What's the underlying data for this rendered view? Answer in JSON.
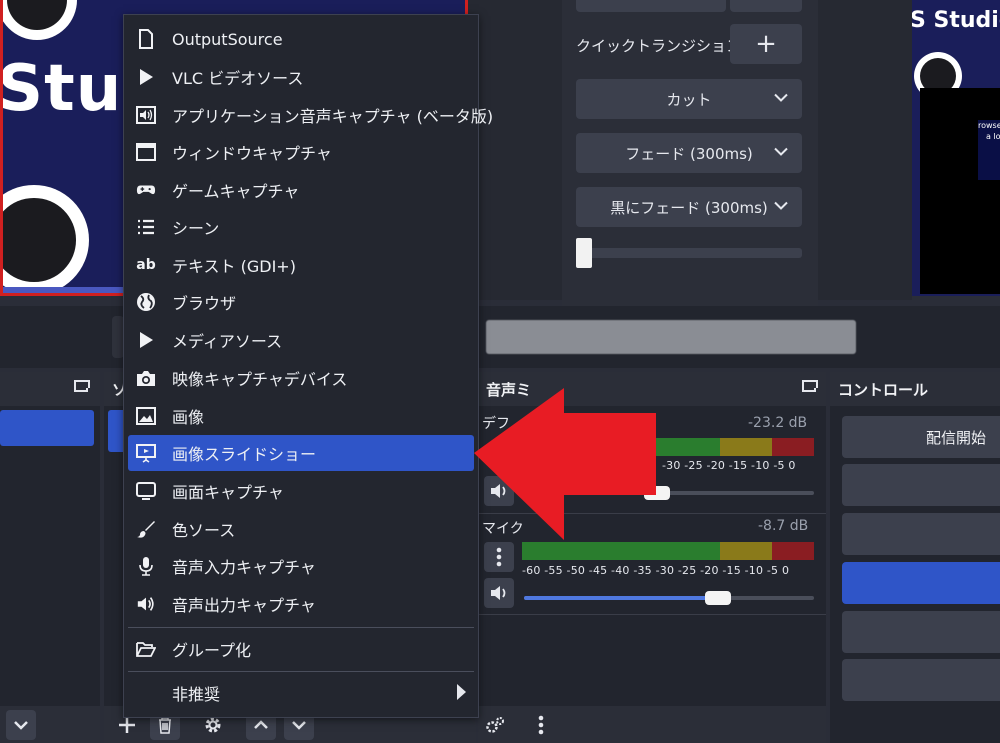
{
  "preview": {
    "left_text": "Stud",
    "right_text": "S Studio",
    "browser_text_1": "rowse",
    "browser_text_2": "a lo"
  },
  "transition": {
    "quick_label": "クイックトランジション",
    "add_symbol": "+",
    "options": [
      "カット",
      "フェード (300ms)",
      "黒にフェード (300ms)"
    ]
  },
  "docks": {
    "mixer_title": "音声ミキサー",
    "mixer_title_visible": "音声ミ",
    "controls_title": "コントロール",
    "sources_title_visible": "ソ"
  },
  "mixer": {
    "channels": [
      {
        "name": "デスクトップ音声",
        "name_visible": "デフ",
        "db": "-23.2 dB",
        "volume": 0.33
      },
      {
        "name": "マイク",
        "name_visible": "マイク",
        "db": "-8.7 dB",
        "volume": 0.7
      }
    ],
    "scale_short": "-30  -25  -20  -15  -10   -5    0",
    "scale_full": "-60 -55 -50 -45 -40 -35 -30 -25 -20 -15 -10  -5   0"
  },
  "controls": {
    "start_stream": "配信開始"
  },
  "menu": {
    "items": [
      {
        "label": "OutputSource",
        "icon": "file-icon"
      },
      {
        "label": "VLC ビデオソース",
        "icon": "play-icon"
      },
      {
        "label": "アプリケーション音声キャプチャ (ベータ版)",
        "icon": "app-audio-icon"
      },
      {
        "label": "ウィンドウキャプチャ",
        "icon": "window-icon"
      },
      {
        "label": "ゲームキャプチャ",
        "icon": "gamepad-icon"
      },
      {
        "label": "シーン",
        "icon": "list-icon"
      },
      {
        "label": "テキスト (GDI+)",
        "icon": "text-icon"
      },
      {
        "label": "ブラウザ",
        "icon": "globe-icon"
      },
      {
        "label": "メディアソース",
        "icon": "play-icon"
      },
      {
        "label": "映像キャプチャデバイス",
        "icon": "camera-icon"
      },
      {
        "label": "画像",
        "icon": "image-icon"
      },
      {
        "label": "画像スライドショー",
        "icon": "slideshow-icon"
      },
      {
        "label": "画面キャプチャ",
        "icon": "monitor-icon"
      },
      {
        "label": "色ソース",
        "icon": "brush-icon"
      },
      {
        "label": "音声入力キャプチャ",
        "icon": "microphone-icon"
      },
      {
        "label": "音声出力キャプチャ",
        "icon": "speaker-icon"
      }
    ],
    "group_label": "グループ化",
    "deprecated_label": "非推奨",
    "selected_index": 11
  },
  "colors": {
    "accent": "#2f55c8",
    "arrow": "#e81c24",
    "panel": "#22252e"
  }
}
